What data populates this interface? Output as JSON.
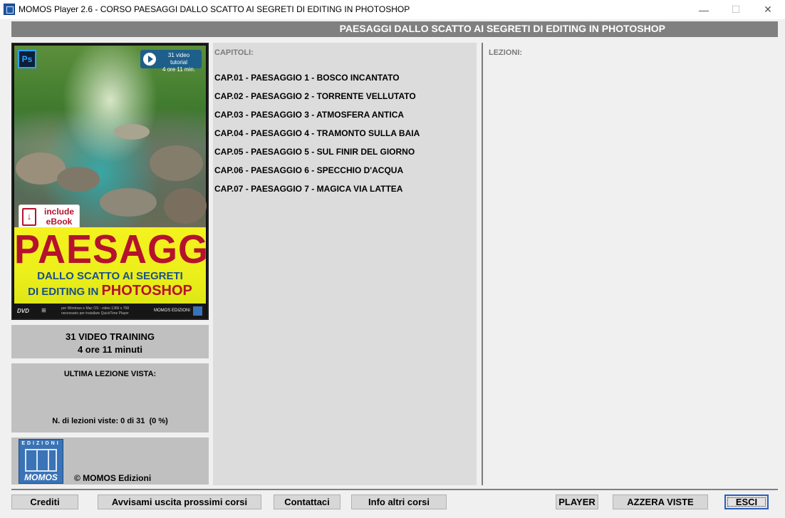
{
  "window": {
    "title": "MOMOS Player 2.6 - CORSO PAESAGGI DALLO SCATTO AI SEGRETI DI EDITING IN PHOTOSHOP",
    "minimize_glyph": "—",
    "maximize_glyph": "☐",
    "close_glyph": "✕"
  },
  "header": {
    "title": "PAESAGGI DALLO SCATTO AI SEGRETI DI EDITING IN PHOTOSHOP"
  },
  "cover": {
    "ps_label": "Ps",
    "video_badge_line1": "31 video tutorial",
    "video_badge_line2": "4 ore 11 min.",
    "ebook_line1": "include",
    "ebook_line2": "eBook",
    "ebook_icon_glyph": "↓",
    "main_title": "PAESAGGI",
    "subtitle_line1": "DALLO SCATTO AI SEGRETI",
    "subtitle_line2_prefix": "DI EDITING IN ",
    "subtitle_line2_highlight": "PHOTOSHOP",
    "dvd_label": "DVD",
    "os_icons": "⊞ ",
    "spec_line1": "per Windows e Mac OS - video 1366 x 768",
    "spec_line2": "necessario per installare QuickTime Player",
    "publisher": "MOMOS EDIZIONI",
    "colors": {
      "title_red": "#b5122d",
      "subtitle_blue": "#1b4f8a",
      "yellow": "#f4f21f"
    }
  },
  "training": {
    "line1": "31 VIDEO TRAINING",
    "line2": "4 ore 11 minuti"
  },
  "last_lesson": {
    "label": "ULTIMA LEZIONE VISTA:",
    "progress": "N. di lezioni viste: 0 di 31  (0 %)"
  },
  "logo": {
    "top_text": "EDIZIONI",
    "bottom_text": "MOMOS",
    "copyright": "© MOMOS Edizioni"
  },
  "chapters": {
    "label": "CAPITOLI:",
    "items": [
      "CAP.01 - PAESAGGIO 1 - BOSCO INCANTATO",
      "CAP.02 - PAESAGGIO 2 - TORRENTE VELLUTATO",
      "CAP.03 - PAESAGGIO 3 - ATMOSFERA ANTICA",
      "CAP.04 - PAESAGGIO 4 - TRAMONTO SULLA BAIA",
      "CAP.05 - PAESAGGIO 5 - SUL FINIR DEL GIORNO",
      "CAP.06 - PAESAGGIO 6 - SPECCHIO D'ACQUA",
      "CAP.07 - PAESAGGIO 7 - MAGICA VIA LATTEA"
    ]
  },
  "lessons": {
    "label": "LEZIONI:"
  },
  "buttons": {
    "crediti": "Crediti",
    "avvisami": "Avvisami uscita prossimi corsi",
    "contattaci": "Contattaci",
    "info": "Info altri corsi",
    "player": "PLAYER",
    "azzera": "AZZERA VISTE",
    "esci": "ESCI"
  }
}
